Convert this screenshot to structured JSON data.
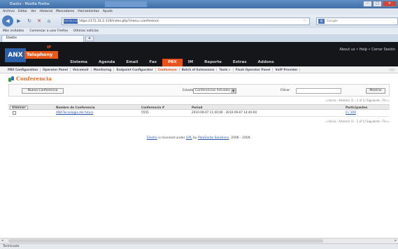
{
  "browser": {
    "window_title": "Elastix - Mozilla Firefox",
    "menu": [
      "Archivo",
      "Editar",
      "Ver",
      "Historial",
      "Marcadores",
      "Herramientas",
      "Ayuda"
    ],
    "url_host": "172.31.2.119",
    "url": "https://172.31.2.119/index.php?menu=conference",
    "search_placeholder": "Google",
    "bookmarks": [
      "Más visitados",
      "Comenzar a usar Firefox",
      "Últimas noticias"
    ],
    "tab_label": "Elastix",
    "new_tab": "+",
    "status": "Terminado"
  },
  "header": {
    "logo_main": "ANX",
    "logo_sub": "Telephony",
    "logo_ip": "IP",
    "top_links": "About us  •  Help  •  Cerrar Sesión",
    "nav": [
      "Sistema",
      "Agenda",
      "Email",
      "Fax",
      "PBX",
      "IM",
      "Reporte",
      "Extras",
      "Addons"
    ],
    "active_nav": "PBX"
  },
  "subnav": {
    "items": [
      "PBX Configuration",
      "Operator Panel",
      "Voicemail",
      "Monitoring",
      "Endpoint Configurator",
      "Conference",
      "Batch of Extensions",
      "Tools »",
      "Flash Operator Panel",
      "VoIP Provider"
    ],
    "active": "Conference",
    "arrows": "◁ ▷"
  },
  "page": {
    "title": "Conferencia",
    "new_button": "Nuevo Conferencia",
    "estado_label": "Estado:",
    "estado_value": "Conferencias Actuales",
    "filtrar_label": "Filtrar:",
    "filtrar_value": "",
    "mostrar_button": "Mostrar",
    "pager": "◁ Inicio  ‹ Anterior  (1 - 1 of 1)  Siguiente ›  Fin ▷",
    "delete_button": "Eliminar",
    "columns": [
      "Nombre de Conferencia",
      "Conferencia #",
      "Period",
      "Participantes"
    ],
    "rows": [
      {
        "name": "ANX-Tecnologia del futuro",
        "number": "5555",
        "period": "2010-09-07 11:40:00 - 2010-09-07 14:40:00",
        "participants": "0 / 100"
      }
    ]
  },
  "footer": {
    "brand": "Elastix",
    "text1": " is licensed under ",
    "license": "GPL",
    "text2": " by ",
    "company": "PaloSanto Solutions",
    "text3": ". 2006 - 2009."
  }
}
